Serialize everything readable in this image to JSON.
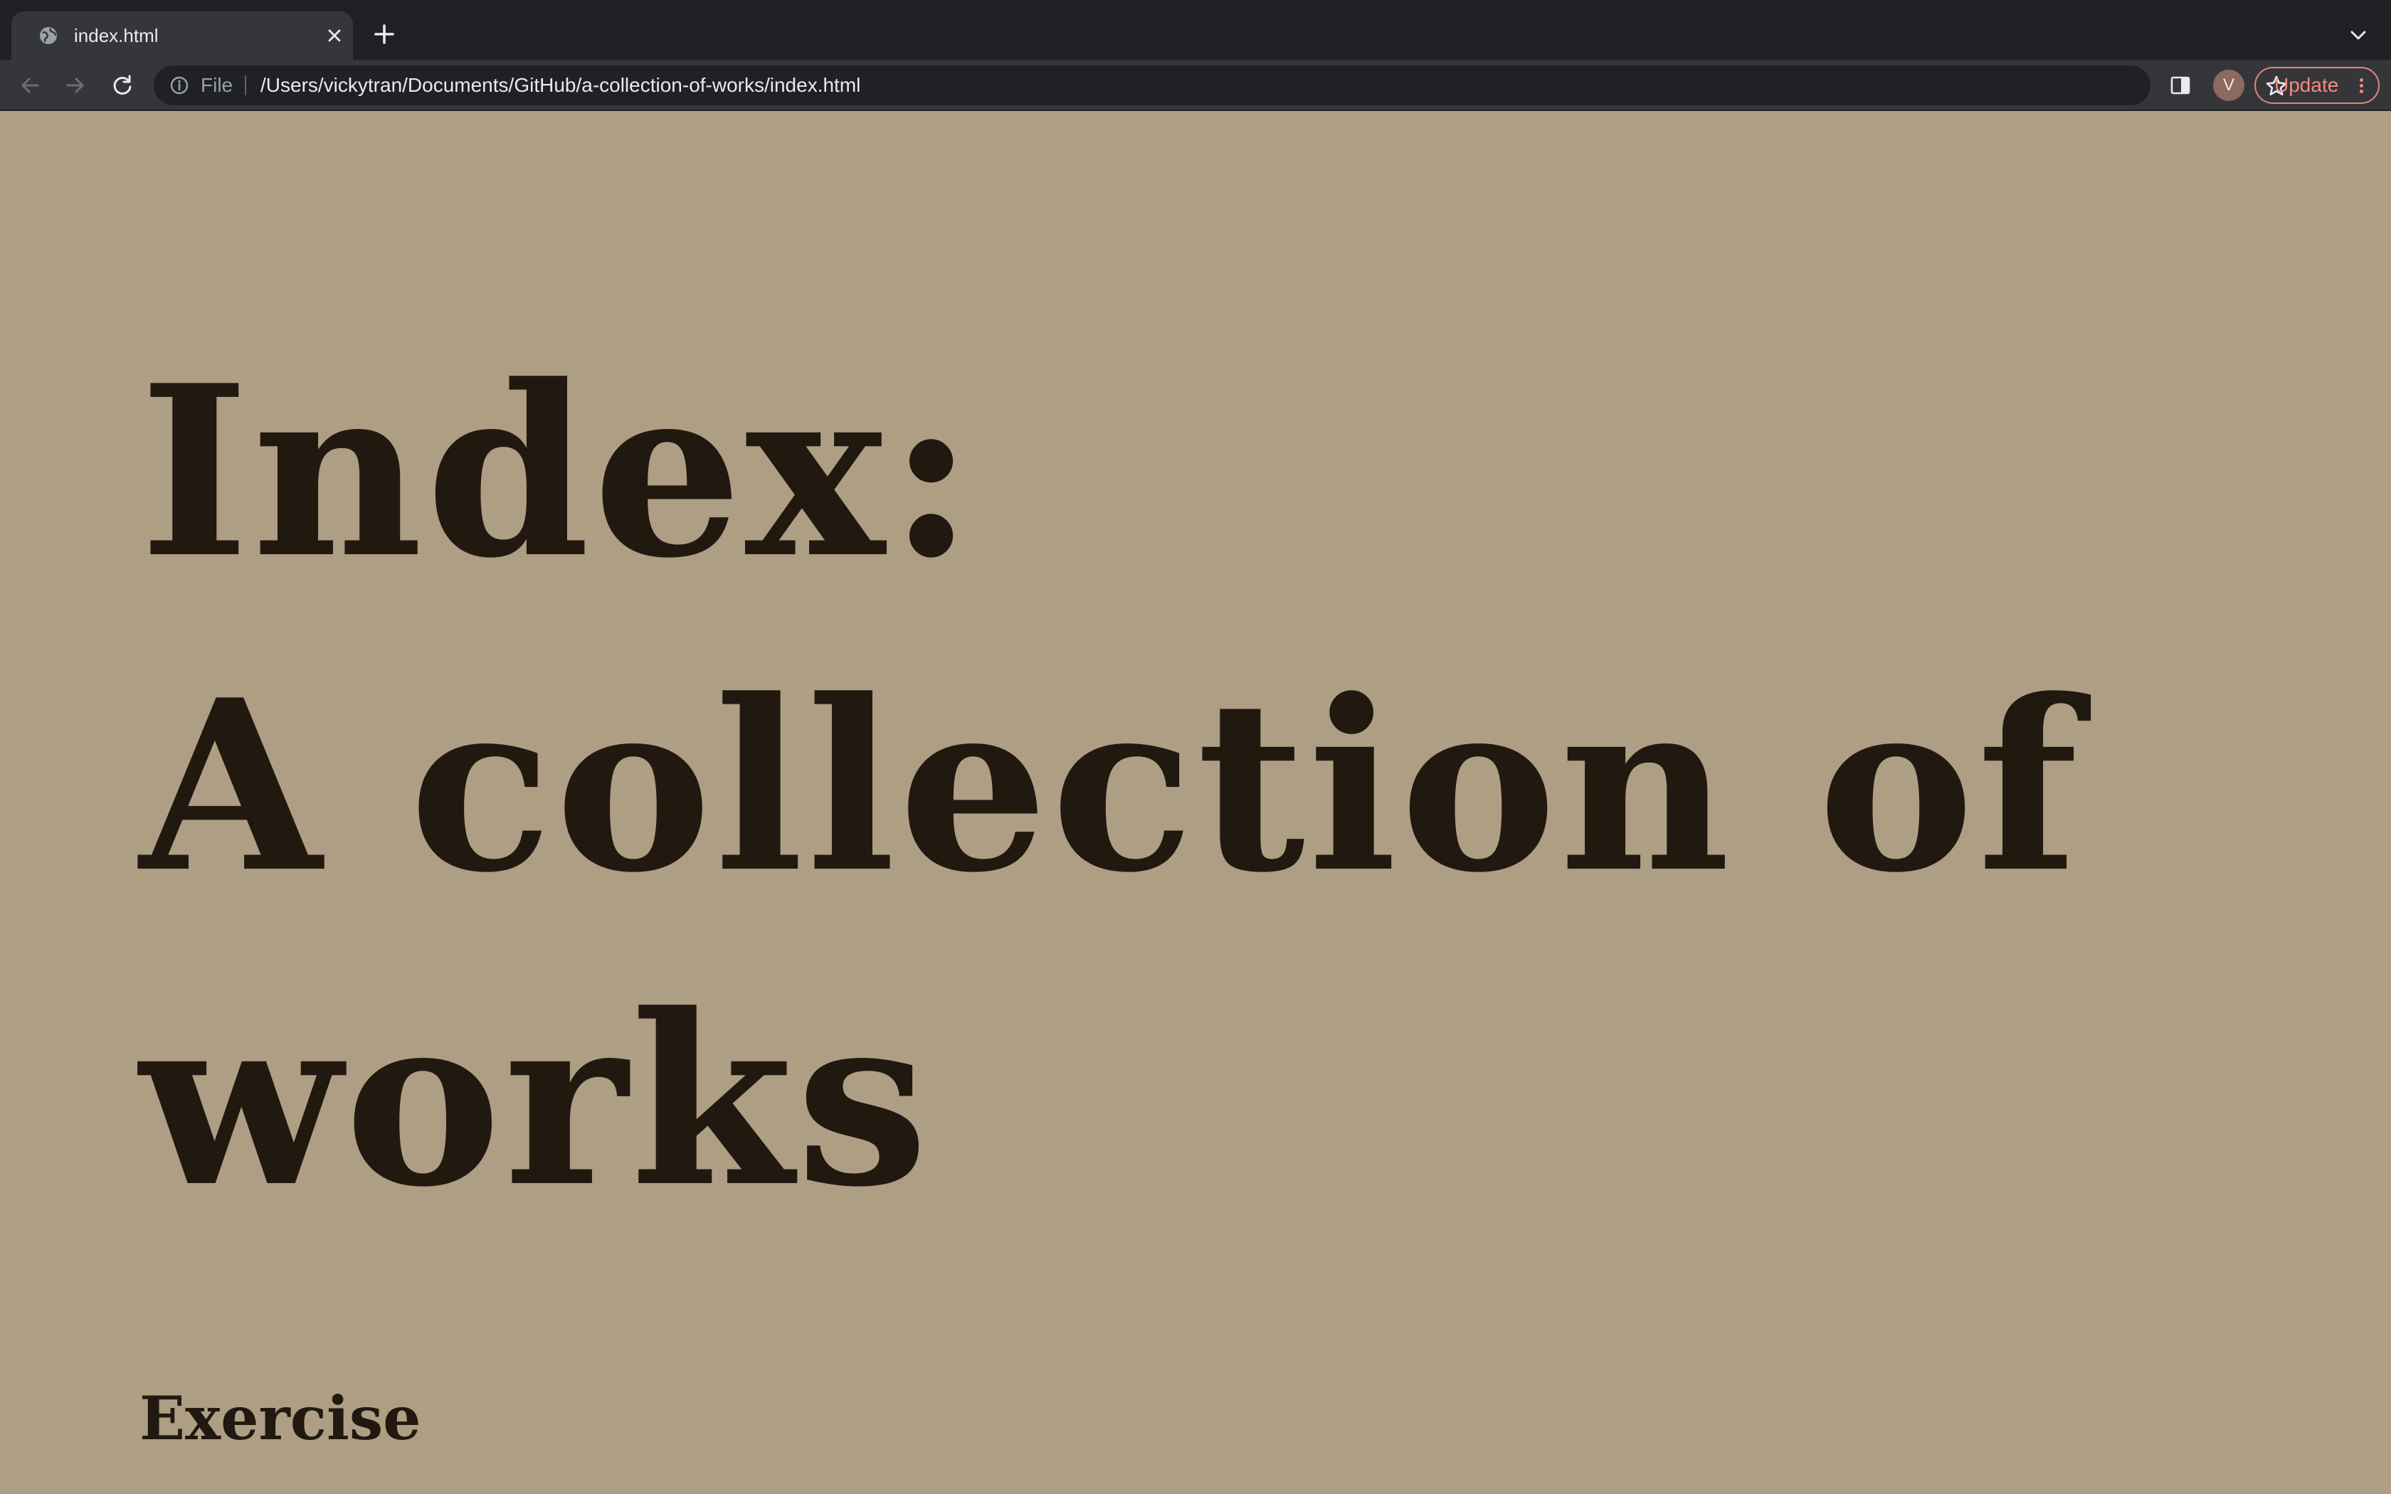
{
  "browser": {
    "tab": {
      "title": "index.html",
      "favicon": "globe-icon",
      "close_icon": "close-icon"
    },
    "new_tab_icon": "plus-icon",
    "tab_search_icon": "chevron-down-icon",
    "toolbar": {
      "back_icon": "arrow-left-icon",
      "forward_icon": "arrow-right-icon",
      "reload_icon": "reload-icon",
      "omnibox": {
        "security_icon": "info-icon",
        "scheme_label": "File",
        "url": "/Users/vickytran/Documents/GitHub/a-collection-of-works/index.html"
      },
      "share_icon": "share-icon",
      "bookmark_icon": "star-icon",
      "side_panel_icon": "side-panel-icon",
      "profile_initial": "V",
      "update_label": "Update"
    }
  },
  "page": {
    "title_lines": [
      "Index:",
      "A collection of",
      "works"
    ],
    "section_heading": "Exercise"
  },
  "colors": {
    "page_background": "#ae9e84",
    "text": "#211910",
    "chrome_dark": "#1f2023",
    "chrome_toolbar": "#35363a",
    "update_accent": "#f28b82"
  }
}
